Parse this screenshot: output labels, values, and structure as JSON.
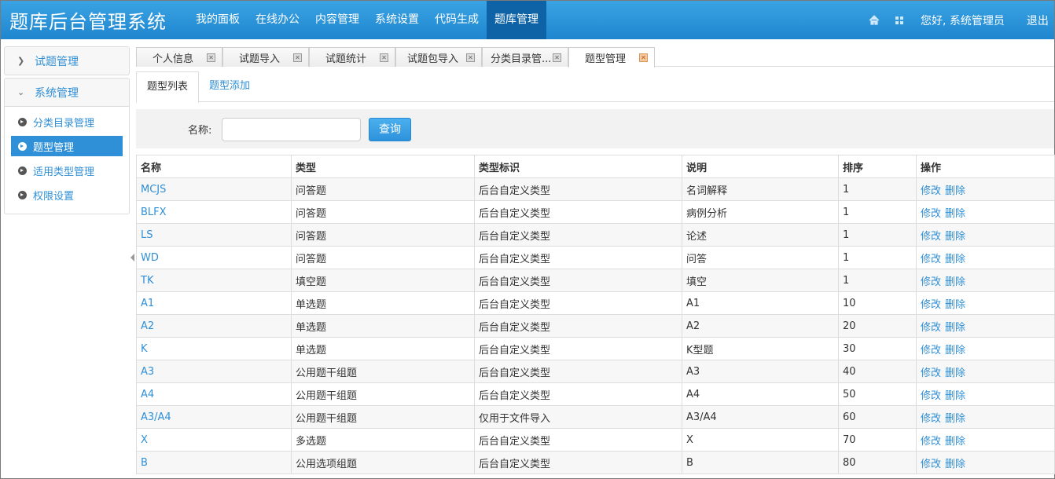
{
  "brand": "题库后台管理系统",
  "topnav": [
    "我的面板",
    "在线办公",
    "内容管理",
    "系统设置",
    "代码生成",
    "题库管理"
  ],
  "topnav_active_index": 5,
  "greeting": "您好, 系统管理员",
  "logout": "退出",
  "sidebar": {
    "groups": [
      {
        "label": "试题管理",
        "expanded": false
      },
      {
        "label": "系统管理",
        "expanded": true
      }
    ],
    "items": [
      "分类目录管理",
      "题型管理",
      "适用类型管理",
      "权限设置"
    ],
    "active_index": 1
  },
  "pagetabs": [
    "个人信息",
    "试题导入",
    "试题统计",
    "试题包导入",
    "分类目录管...",
    "题型管理"
  ],
  "pagetabs_active_index": 5,
  "subtabs": [
    "题型列表",
    "题型添加"
  ],
  "search": {
    "label": "名称:",
    "value": "",
    "button": "查询"
  },
  "table": {
    "headers": [
      "名称",
      "类型",
      "类型标识",
      "说明",
      "排序",
      "操作"
    ],
    "actions": [
      "修改",
      "删除"
    ],
    "rows": [
      [
        "MCJS",
        "问答题",
        "后台自定义类型",
        "名词解释",
        "1"
      ],
      [
        "BLFX",
        "问答题",
        "后台自定义类型",
        "病例分析",
        "1"
      ],
      [
        "LS",
        "问答题",
        "后台自定义类型",
        "论述",
        "1"
      ],
      [
        "WD",
        "问答题",
        "后台自定义类型",
        "问答",
        "1"
      ],
      [
        "TK",
        "填空题",
        "后台自定义类型",
        "填空",
        "1"
      ],
      [
        "A1",
        "单选题",
        "后台自定义类型",
        "A1",
        "10"
      ],
      [
        "A2",
        "单选题",
        "后台自定义类型",
        "A2",
        "20"
      ],
      [
        "K",
        "单选题",
        "后台自定义类型",
        "K型题",
        "30"
      ],
      [
        "A3",
        "公用题干组题",
        "后台自定义类型",
        "A3",
        "40"
      ],
      [
        "A4",
        "公用题干组题",
        "后台自定义类型",
        "A4",
        "50"
      ],
      [
        "A3/A4",
        "公用题干组题",
        "仅用于文件导入",
        "A3/A4",
        "60"
      ],
      [
        "X",
        "多选题",
        "后台自定义类型",
        "X",
        "70"
      ],
      [
        "B",
        "公用选项组题",
        "后台自定义类型",
        "B",
        "80"
      ]
    ]
  },
  "colors": {
    "accent": "#2f8fd6",
    "topbar": "#2a94d8",
    "active_nav": "#0d63a5"
  }
}
